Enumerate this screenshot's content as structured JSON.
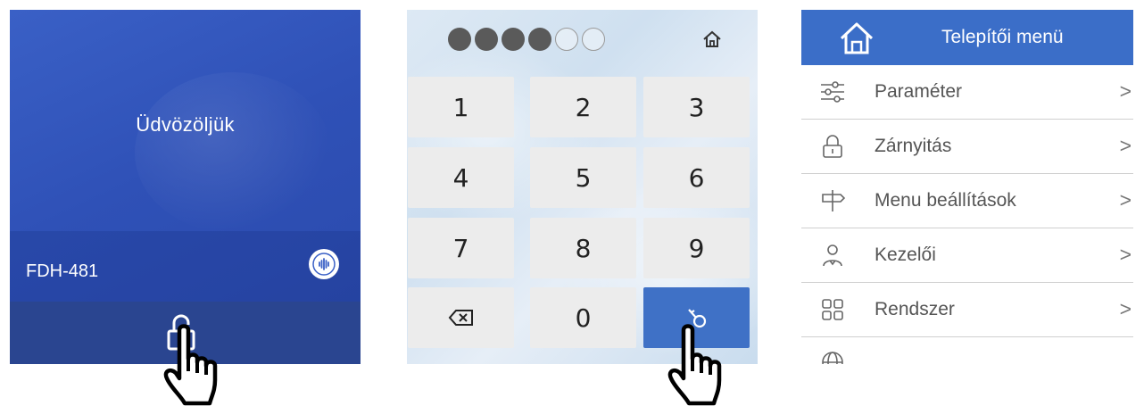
{
  "welcome_screen": {
    "greeting": "Üdvözöljük",
    "device_name": "FDH-481",
    "voice_icon": "voice-wave-icon",
    "unlock_icon": "padlock-open-icon"
  },
  "keypad_screen": {
    "pin_dots": {
      "total": 6,
      "filled": 4
    },
    "home_icon": "home-icon",
    "keys": [
      "1",
      "2",
      "3",
      "4",
      "5",
      "6",
      "7",
      "8",
      "9",
      "⌫",
      "0",
      "🔑"
    ],
    "backspace_icon": "backspace-icon",
    "enter_icon": "key-icon"
  },
  "installer_menu": {
    "title": "Telepítői menü",
    "home_icon": "home-icon",
    "items": [
      {
        "label": "Paraméter",
        "icon": "sliders-icon",
        "chevron": ">"
      },
      {
        "label": "Zárnyitás",
        "icon": "lock-icon",
        "chevron": ">"
      },
      {
        "label": "Menu beállítások",
        "icon": "signpost-icon",
        "chevron": ">"
      },
      {
        "label": "Kezelői",
        "icon": "user-icon",
        "chevron": ">"
      },
      {
        "label": "Rendszer",
        "icon": "grid-icon",
        "chevron": ">"
      },
      {
        "label": "",
        "icon": "globe-icon",
        "chevron": ""
      }
    ]
  },
  "colors": {
    "welcome_bg": "#2f51b7",
    "menu_header": "#3b6ec8",
    "enter_key": "#3f71c6",
    "key_bg": "#ececec"
  }
}
